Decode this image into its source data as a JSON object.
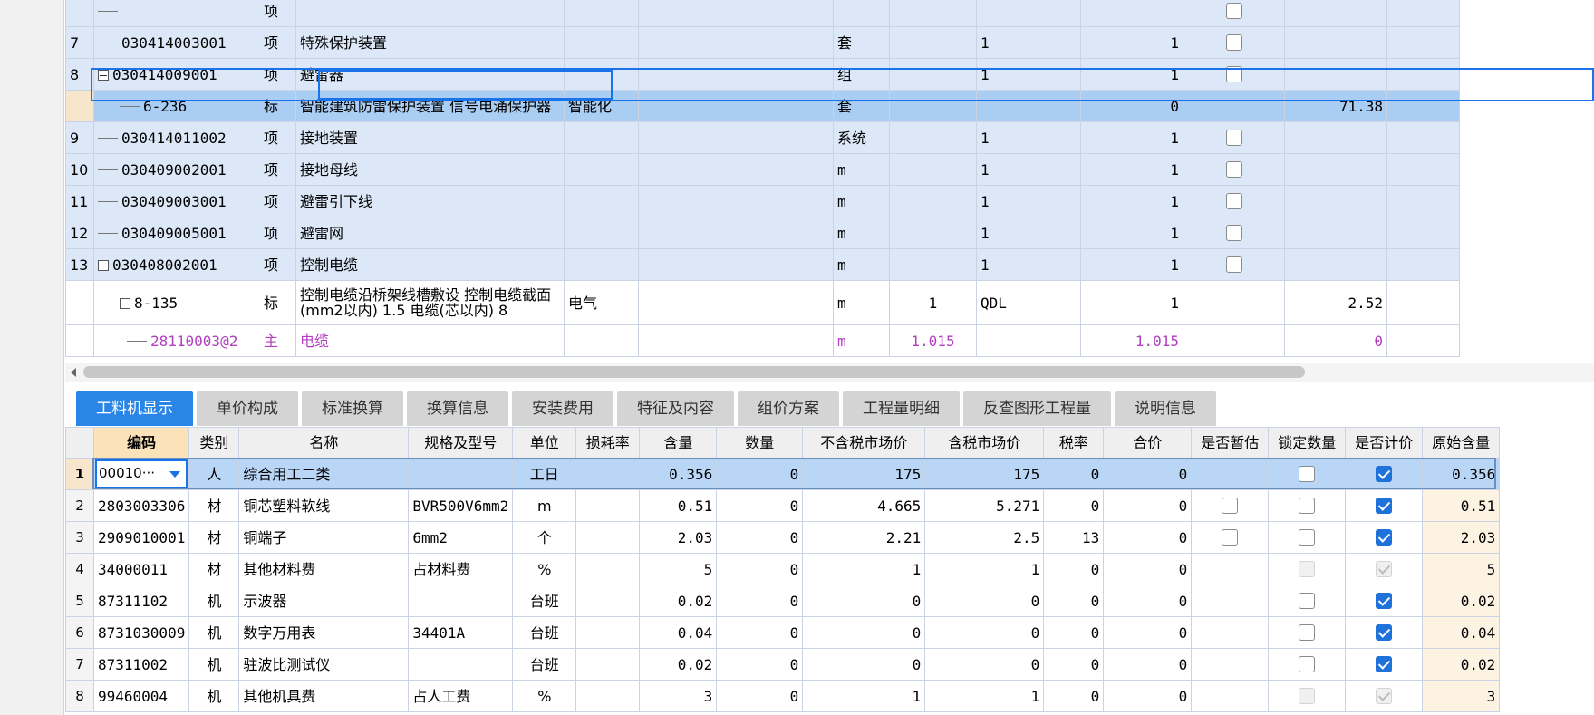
{
  "upper_rows": [
    {
      "no": "",
      "code": "",
      "type": "项",
      "name": "",
      "spec": "",
      "unit": "",
      "qty": "",
      "expr": "",
      "result": "",
      "price": "",
      "style": "blue",
      "check": "box"
    },
    {
      "no": "7",
      "code": "030414003001",
      "type": "项",
      "name": "特殊保护装置",
      "spec": "",
      "unit": "套",
      "qty": "",
      "expr": "1",
      "result": "1",
      "price": "",
      "style": "blue",
      "check": "box"
    },
    {
      "no": "8",
      "code": "030414009001",
      "type": "项",
      "name": "避雷器",
      "spec": "",
      "unit": "组",
      "qty": "",
      "expr": "1",
      "result": "1",
      "price": "",
      "style": "blue",
      "check": "box",
      "tree": "box"
    },
    {
      "no": "",
      "code": "6-236",
      "type": "标",
      "name": "智能建筑防雷保护装置 信号电涌保护器",
      "spec": "智能化",
      "unit": "套",
      "qty": "",
      "expr": "",
      "result": "0",
      "price": "71.38",
      "style": "sel",
      "check": "none",
      "indent": "sub"
    },
    {
      "no": "9",
      "code": "030414011002",
      "type": "项",
      "name": "接地装置",
      "spec": "",
      "unit": "系统",
      "qty": "",
      "expr": "1",
      "result": "1",
      "price": "",
      "style": "blue",
      "check": "box"
    },
    {
      "no": "10",
      "code": "030409002001",
      "type": "项",
      "name": "接地母线",
      "spec": "",
      "unit": "m",
      "qty": "",
      "expr": "1",
      "result": "1",
      "price": "",
      "style": "blue",
      "check": "box"
    },
    {
      "no": "11",
      "code": "030409003001",
      "type": "项",
      "name": "避雷引下线",
      "spec": "",
      "unit": "m",
      "qty": "",
      "expr": "1",
      "result": "1",
      "price": "",
      "style": "blue",
      "check": "box"
    },
    {
      "no": "12",
      "code": "030409005001",
      "type": "项",
      "name": "避雷网",
      "spec": "",
      "unit": "m",
      "qty": "",
      "expr": "1",
      "result": "1",
      "price": "",
      "style": "blue",
      "check": "box"
    },
    {
      "no": "13",
      "code": "030408002001",
      "type": "项",
      "name": "控制电缆",
      "spec": "",
      "unit": "m",
      "qty": "",
      "expr": "1",
      "result": "1",
      "price": "",
      "style": "blue",
      "check": "box",
      "tree": "box"
    },
    {
      "no": "",
      "code": "8-135",
      "type": "标",
      "name": "控制电缆沿桥架线槽敷设 控制电缆截面(mm2以内) 1.5 电缆(芯以内) 8",
      "name_line1": "控制电缆沿桥架线槽敷设 控制电缆截面",
      "name_line2": "(mm2以内) 1.5 电缆(芯以内) 8",
      "spec": "电气",
      "unit": "m",
      "qty": "1",
      "expr": "QDL",
      "result": "1",
      "price": "2.52",
      "style": "white",
      "check": "none",
      "indent": "sub",
      "tree": "box"
    },
    {
      "no": "",
      "code": "28110003@2",
      "type": "主",
      "name": "电缆",
      "spec": "",
      "unit": "m",
      "qty": "1.015",
      "expr": "",
      "result": "1.015",
      "price": "0",
      "style": "pink",
      "check": "none",
      "indent": "sub2"
    }
  ],
  "tabs": [
    "工料机显示",
    "单价构成",
    "标准换算",
    "换算信息",
    "安装费用",
    "特征及内容",
    "组价方案",
    "工程量明细",
    "反查图形工程量",
    "说明信息"
  ],
  "active_tab": "工料机显示",
  "lower_headers": [
    "编码",
    "类别",
    "名称",
    "规格及型号",
    "单位",
    "损耗率",
    "含量",
    "数量",
    "不含税市场价",
    "含税市场价",
    "税率",
    "合价",
    "是否暂估",
    "锁定数量",
    "是否计价",
    "原始含量"
  ],
  "lower_rows": [
    {
      "no": "1",
      "code": "00010···",
      "type": "人",
      "name": "综合用工二类",
      "spec": "",
      "unit": "工日",
      "loss": "",
      "content": "0.356",
      "qty": "0",
      "price_ex": "175",
      "price_in": "175",
      "tax": "0",
      "total": "0",
      "prov": "none",
      "lock": "off",
      "priced": "on",
      "orig": "0.356"
    },
    {
      "no": "2",
      "code": "2803003306",
      "type": "材",
      "name": "铜芯塑料软线",
      "spec": "BVR500V6mm2",
      "unit": "m",
      "loss": "",
      "content": "0.51",
      "qty": "0",
      "price_ex": "4.665",
      "price_in": "5.271",
      "tax": "0",
      "total": "0",
      "prov": "off",
      "lock": "off",
      "priced": "on",
      "orig": "0.51"
    },
    {
      "no": "3",
      "code": "2909010001",
      "type": "材",
      "name": "铜端子",
      "spec": "6mm2",
      "unit": "个",
      "loss": "",
      "content": "2.03",
      "qty": "0",
      "price_ex": "2.21",
      "price_in": "2.5",
      "tax": "13",
      "total": "0",
      "prov": "off",
      "lock": "off",
      "priced": "on",
      "orig": "2.03"
    },
    {
      "no": "4",
      "code": "34000011",
      "type": "材",
      "name": "其他材料费",
      "spec": "占材料费",
      "unit": "%",
      "loss": "",
      "content": "5",
      "qty": "0",
      "price_ex": "1",
      "price_in": "1",
      "tax": "0",
      "total": "0",
      "prov": "none",
      "lock": "dis",
      "priced": "dis-on",
      "orig": "5"
    },
    {
      "no": "5",
      "code": "87311102",
      "type": "机",
      "name": "示波器",
      "spec": "",
      "unit": "台班",
      "loss": "",
      "content": "0.02",
      "qty": "0",
      "price_ex": "0",
      "price_in": "0",
      "tax": "0",
      "total": "0",
      "prov": "none",
      "lock": "off",
      "priced": "on",
      "orig": "0.02"
    },
    {
      "no": "6",
      "code": "8731030009",
      "type": "机",
      "name": "数字万用表",
      "spec": "34401A",
      "unit": "台班",
      "loss": "",
      "content": "0.04",
      "qty": "0",
      "price_ex": "0",
      "price_in": "0",
      "tax": "0",
      "total": "0",
      "prov": "none",
      "lock": "off",
      "priced": "on",
      "orig": "0.04"
    },
    {
      "no": "7",
      "code": "87311002",
      "type": "机",
      "name": "驻波比测试仪",
      "spec": "",
      "unit": "台班",
      "loss": "",
      "content": "0.02",
      "qty": "0",
      "price_ex": "0",
      "price_in": "0",
      "tax": "0",
      "total": "0",
      "prov": "none",
      "lock": "off",
      "priced": "on",
      "orig": "0.02"
    },
    {
      "no": "8",
      "code": "99460004",
      "type": "机",
      "name": "其他机具费",
      "spec": "占人工费",
      "unit": "%",
      "loss": "",
      "content": "3",
      "qty": "0",
      "price_ex": "1",
      "price_in": "1",
      "tax": "0",
      "total": "0",
      "prov": "none",
      "lock": "dis",
      "priced": "dis-on",
      "orig": "3"
    }
  ],
  "colors": {
    "accent": "#2a86e6",
    "row_blue": "#dce8f8",
    "row_selected": "#a9cdf3",
    "highlight": "#fbe2b8",
    "pink_text": "#b23fbf"
  }
}
